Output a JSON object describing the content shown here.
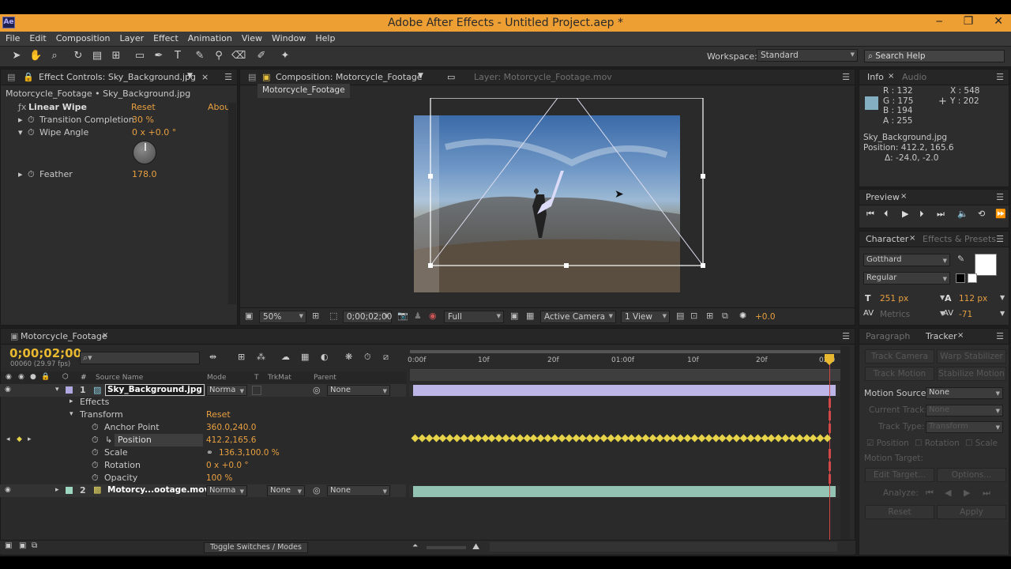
{
  "window": {
    "title": "Adobe After Effects - Untitled Project.aep *",
    "app_icon": "Ae",
    "controls": [
      "‒",
      "❐",
      "✕"
    ]
  },
  "menu": [
    "File",
    "Edit",
    "Composition",
    "Layer",
    "Effect",
    "Animation",
    "View",
    "Window",
    "Help"
  ],
  "toolbar": {
    "workspace_label": "Workspace:",
    "workspace_value": "Standard",
    "search_placeholder": "Search Help"
  },
  "effect_controls": {
    "tab": "Effect Controls: Sky_Background.jpg",
    "breadcrumb": "Motorcycle_Footage • Sky_Background.jpg",
    "effect_name": "Linear Wipe",
    "reset": "Reset",
    "about": "Abou",
    "props": [
      {
        "name": "Transition Completion",
        "value": "30 %"
      },
      {
        "name": "Wipe Angle",
        "value": "0 x +0.0 °"
      },
      {
        "name": "Feather",
        "value": "178.0"
      }
    ]
  },
  "composition": {
    "tab": "Composition: Motorcycle_Footage",
    "layer_tab": "Layer: Motorcycle_Footage.mov",
    "subtab": "Motorcycle_Footage",
    "zoom": "50%",
    "timecode": "0;00;02;00",
    "resolution": "Full",
    "camera": "Active Camera",
    "views": "1 View",
    "exposure": "+0.0"
  },
  "info": {
    "tabs": [
      "Info",
      "Audio"
    ],
    "swatch_color": "#84afc2",
    "rgba": [
      "R : 132",
      "G : 175",
      "B : 194",
      "A : 255"
    ],
    "xy": [
      "X : 548",
      "Y : 202"
    ],
    "layer": "Sky_Background.jpg",
    "position": "Position: 412.2, 165.6",
    "delta": "Δ: -24.0, -2.0"
  },
  "preview": {
    "tab": "Preview"
  },
  "character": {
    "tabs": [
      "Character",
      "Effects & Presets"
    ],
    "font": "Gotthard",
    "style": "Regular",
    "size": "251 px",
    "leading": "112 px",
    "kerning": "Metrics",
    "tracking": "-71"
  },
  "timeline": {
    "tab": "Motorcycle_Footage",
    "timecode": "0;00;02;00",
    "fps": "00060 (29.97 fps)",
    "toggle_label": "Toggle Switches / Modes",
    "headers": {
      "source": "Source Name",
      "mode": "Mode",
      "t": "T",
      "trkmat": "TrkMat",
      "parent": "Parent"
    },
    "ruler": [
      "0:00f",
      "10f",
      "20f",
      "01:00f",
      "10f",
      "20f",
      "02:0"
    ],
    "layers": [
      {
        "num": "1",
        "name": "Sky_Background.jpg",
        "mode": "Norma",
        "parent": "None"
      },
      {
        "num": "2",
        "name": "Motorcy...ootage.mov",
        "mode": "Norma",
        "trkmat": "None",
        "parent": "None"
      }
    ],
    "sub": {
      "effects": "Effects",
      "transform": "Transform",
      "reset": "Reset"
    },
    "props": [
      {
        "name": "Anchor Point",
        "value": "360.0,240.0"
      },
      {
        "name": "Position",
        "value": "412.2,165.6"
      },
      {
        "name": "Scale",
        "value": "136.3,100.0 %"
      },
      {
        "name": "Rotation",
        "value": "0 x +0.0 °"
      },
      {
        "name": "Opacity",
        "value": "100 %"
      }
    ]
  },
  "paragraph_tracker": {
    "tabs": [
      "Paragraph",
      "Tracker"
    ],
    "buttons": [
      "Track Camera",
      "Warp Stabilizer",
      "Track Motion",
      "Stabilize Motion"
    ],
    "motion_source_label": "Motion Source:",
    "motion_source": "None",
    "current_track_label": "Current Track:",
    "current_track": "None",
    "track_type_label": "Track Type:",
    "track_type": "Transform",
    "checks": [
      "Position",
      "Rotation",
      "Scale"
    ],
    "motion_target": "Motion Target:",
    "edit_target": "Edit Target...",
    "options": "Options...",
    "analyze": "Analyze:",
    "reset": "Reset",
    "apply": "Apply"
  }
}
